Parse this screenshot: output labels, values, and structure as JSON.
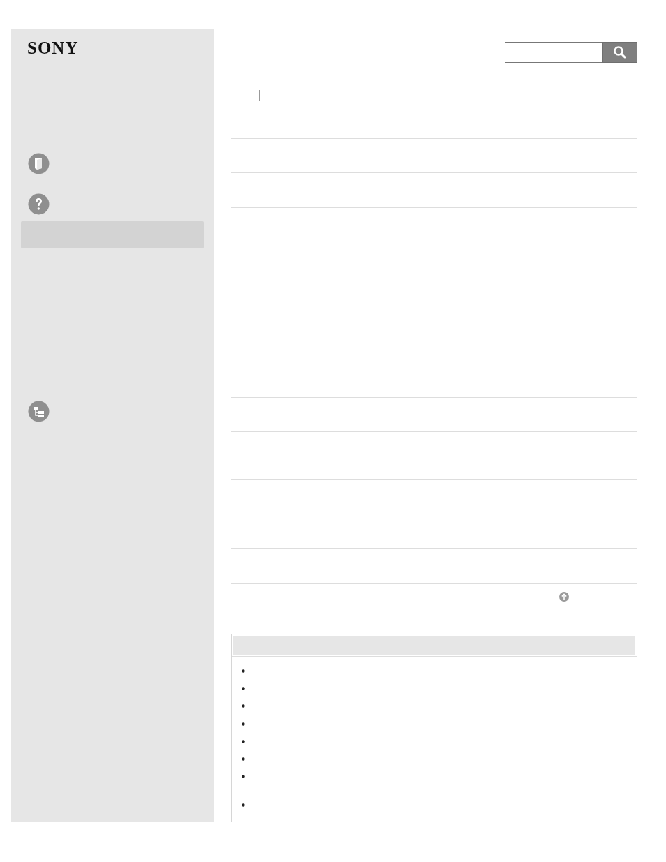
{
  "sidebar": {
    "logo": "SONY"
  }
}
